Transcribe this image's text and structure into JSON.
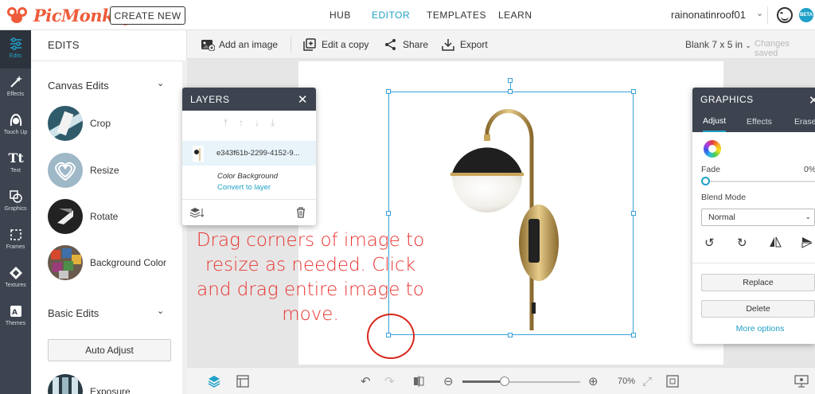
{
  "header": {
    "logo_text": "PicMonkey",
    "create_button": "CREATE NEW",
    "nav": [
      {
        "label": "HUB",
        "active": false
      },
      {
        "label": "EDITOR",
        "active": true
      },
      {
        "label": "TEMPLATES",
        "active": false
      },
      {
        "label": "LEARN",
        "active": false
      }
    ],
    "username": "rainonatinroof01",
    "beta_badge": "BETA"
  },
  "rail": [
    {
      "label": "Edits",
      "icon": "sliders-icon",
      "active": true
    },
    {
      "label": "Effects",
      "icon": "magic-wand-icon",
      "active": false
    },
    {
      "label": "Touch Up",
      "icon": "face-icon",
      "active": false
    },
    {
      "label": "Text",
      "icon": "text-icon",
      "active": false
    },
    {
      "label": "Graphics",
      "icon": "shapes-icon",
      "active": false
    },
    {
      "label": "Frames",
      "icon": "frame-icon",
      "active": false
    },
    {
      "label": "Textures",
      "icon": "texture-icon",
      "active": false
    },
    {
      "label": "Themes",
      "icon": "themes-icon",
      "active": false
    }
  ],
  "edits_panel": {
    "title": "EDITS",
    "canvas_edits": "Canvas Edits",
    "tools": [
      "Crop",
      "Resize",
      "Rotate",
      "Background Color"
    ],
    "basic_edits": "Basic Edits",
    "auto_adjust": "Auto Adjust",
    "exposure": "Exposure"
  },
  "toolbar": {
    "add_image": "Add an image",
    "edit_copy": "Edit a copy",
    "share": "Share",
    "export": "Export",
    "canvas_size": "Blank 7 x 5 in",
    "status": "Changes saved"
  },
  "layers_panel": {
    "title": "LAYERS",
    "layer_name": "e343f61b-2299-4152-9...",
    "color_background": "Color Background",
    "convert_link": "Convert to layer"
  },
  "annotation": "Drag corners of image to resize as needed. Click and drag entire image to move.",
  "graphics_panel": {
    "title": "GRAPHICS",
    "tabs": [
      "Adjust",
      "Effects",
      "Erase"
    ],
    "fade_label": "Fade",
    "fade_value": "0%",
    "fade_fraction": 0.0,
    "blend_label": "Blend Mode",
    "blend_value": "Normal",
    "replace": "Replace",
    "delete": "Delete",
    "more_options": "More options"
  },
  "bottom": {
    "zoom": "70%",
    "zoom_fraction": 0.36
  },
  "colors": {
    "accent": "#20a1c8",
    "brand": "#ef5b3a",
    "panel_dark": "#3d4450",
    "annotation": "#e8332f"
  }
}
